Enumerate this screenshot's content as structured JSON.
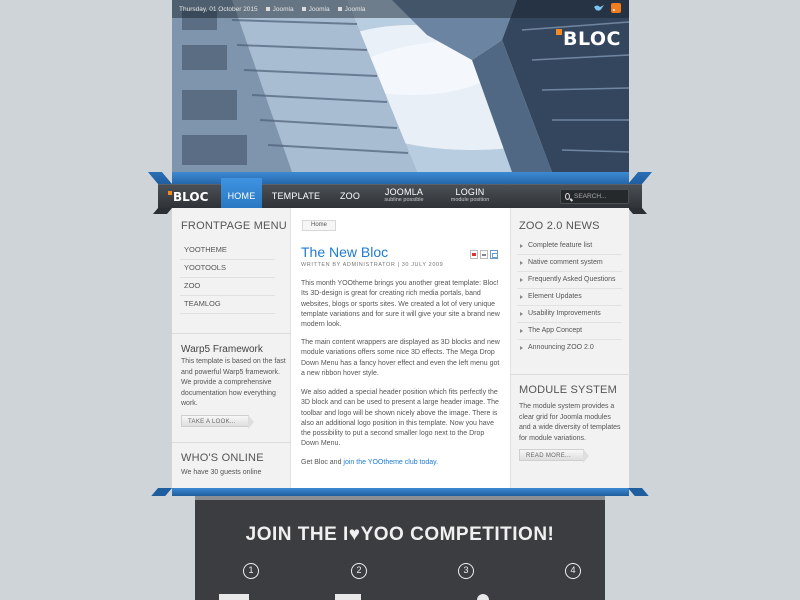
{
  "toolbar": {
    "date": "Thursday, 01 October 2015",
    "links": [
      "Joomla",
      "Joomla",
      "Joomla"
    ],
    "icons": [
      "twitter-bird-icon",
      "rss-icon"
    ]
  },
  "hero": {
    "logo_text": "BLOC"
  },
  "nav": {
    "logo_text": "BLOC",
    "items": [
      {
        "label": "HOME",
        "subtitle": ""
      },
      {
        "label": "TEMPLATE",
        "subtitle": ""
      },
      {
        "label": "ZOO",
        "subtitle": ""
      },
      {
        "label": "JOOMLA",
        "subtitle": "subline possible"
      },
      {
        "label": "LOGIN",
        "subtitle": "module position"
      }
    ],
    "search_placeholder": "SEARCH...",
    "active": "HOME"
  },
  "left": {
    "frontpage_menu": {
      "title": "FRONTPAGE MENU",
      "items": [
        "YOOTHEME",
        "YOOTOOLS",
        "ZOO",
        "TEAMLOG"
      ]
    },
    "warp": {
      "title": "Warp5 Framework",
      "text": "This template is based on the fast and powerful Warp5 framework. We provide a comprehensive documentation how everything work.",
      "button": "TAKE A LOOK..."
    },
    "online": {
      "title": "WHO'S ONLINE",
      "text": "We have 30 guests online"
    }
  },
  "center": {
    "breadcrumb": "Home",
    "title": "The New Bloc",
    "meta": "WRITTEN BY ADMINISTRATOR | 30 JULY 2009",
    "paragraphs": [
      "This month YOOtheme brings you another great template: Bloc! Its 3D-design is great for creating rich media portals, band websites, blogs or sports sites. We created a lot of very unique template variations and for sure it will give your site a brand new modern look.",
      "The main content wrappers are displayed as 3D blocks and new module variations offers some nice 3D effects. The Mega Drop Down Menu has a fancy hover effect and even the left menu got a new ribbon hover style.",
      "We also added a special header position which fits perfectly the 3D block and can be used to present a large header image. The toolbar and logo will be shown nicely above the image. There is also an additional logo position in this template. Now you have the possibility to put a second smaller logo next to the Drop Down Menu."
    ],
    "final_prefix": "Get Bloc and ",
    "final_link": "join the YOOtheme club today."
  },
  "right": {
    "zoo_news": {
      "title": "ZOO 2.0 NEWS",
      "items": [
        "Complete feature list",
        "Native comment system",
        "Frequently Asked Questions",
        "Element Updates",
        "Usability Improvements",
        "The App Concept",
        "Announcing ZOO 2.0"
      ]
    },
    "module_system": {
      "title": "MODULE SYSTEM",
      "text": "The module system provides a clear grid for Joomla modules and a wide diversity of templates for module variations.",
      "button": "READ MORE..."
    }
  },
  "competition": {
    "title": "JOIN THE I♥YOO COMPETITION!",
    "steps": [
      "1",
      "2",
      "3",
      "4"
    ]
  },
  "colors": {
    "accent": "#2a78c4",
    "link": "#1f7bd0",
    "logo_dot": "#f08a24",
    "nav_bg": "#35393d",
    "panel_bg": "#3b3d40"
  }
}
